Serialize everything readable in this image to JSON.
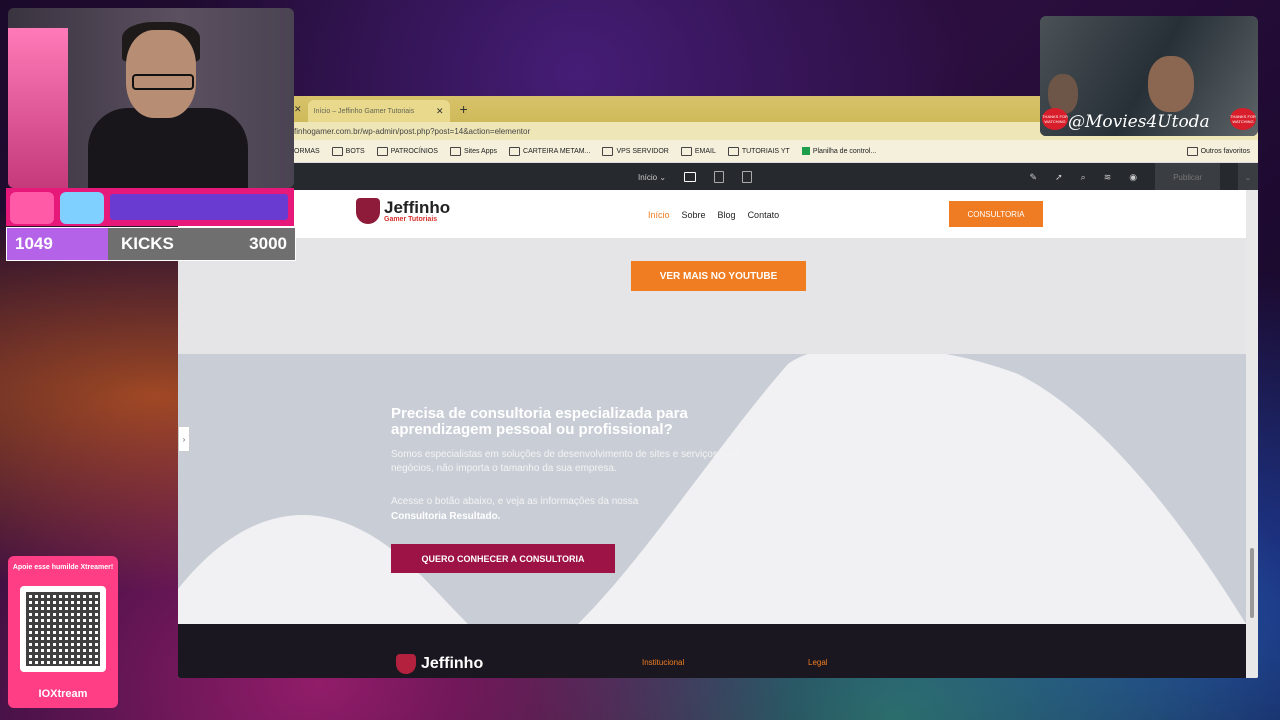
{
  "browser": {
    "tab_title": "Início – Jeffinho Gamer Tutoriais",
    "url": "finhogamer.com.br/wp-admin/post.php?post=14&action=elementor",
    "bookmarks": [
      "ORMAS",
      "BOTS",
      "PATROCÍNIOS",
      "Sites Apps",
      "CARTEIRA METAM...",
      "VPS SERVIDOR",
      "EMAIL",
      "TUTORIAIS YT",
      "Planilha de control..."
    ],
    "bookmarks_right": "Outros favoritos"
  },
  "elementor": {
    "page_select": "Início",
    "publish_label": "Publicar"
  },
  "site": {
    "logo_main": "Jeffinho",
    "logo_sub": "Gamer Tutoriais",
    "nav": [
      "Início",
      "Sobre",
      "Blog",
      "Contato"
    ],
    "header_button": "CONSULTORIA",
    "youtube_button": "VER MAIS NO YOUTUBE",
    "cta_title": "Precisa de consultoria especializada para aprendizagem pessoal ou profissional?",
    "cta_text1": "Somos especialistas em soluções de desenvolvimento de sites e serviços para negócios, não importa o tamanho da sua empresa.",
    "cta_text2": "Acesse o botão abaixo, e veja as informações da nossa",
    "cta_text2_bold": "Consultoria Resultado.",
    "cta_button": "QUERO CONHECER A CONSULTORIA",
    "footer_logo": "Jeffinho",
    "footer_col1": "Institucional",
    "footer_col2": "Legal"
  },
  "stream": {
    "kicks_current": "1049",
    "kicks_label": "KICKS",
    "kicks_goal": "3000",
    "kicks_progress": 0.35,
    "qr_title": "Apoie esse humilde Xtreamer!",
    "qr_brand": "IOXtream",
    "movie_label": "@Movies4Utoda",
    "badge_text": "THANKS FOR WATCHING"
  }
}
